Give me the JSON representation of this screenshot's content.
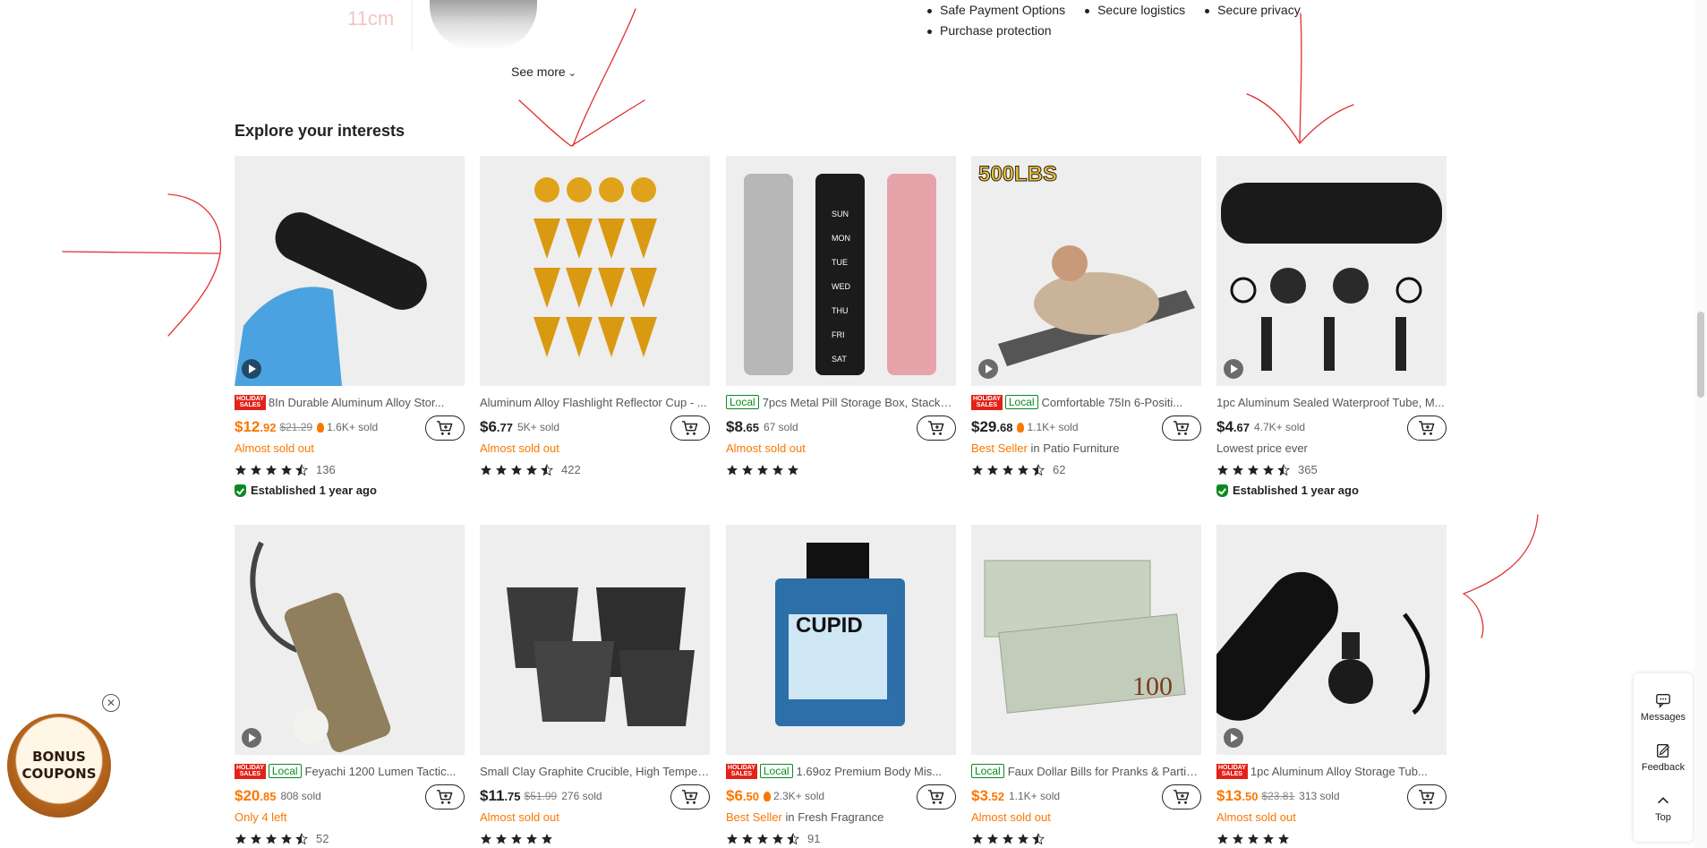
{
  "previous_section": {
    "dimension_label": "11cm",
    "see_more_label": "See more"
  },
  "assurances": [
    "Safe Payment Options",
    "Secure logistics",
    "Secure privacy",
    "Purchase protection"
  ],
  "section_title": "Explore your interests",
  "badges": {
    "holiday_top": "HOLIDAY",
    "holiday_bottom": "SALES",
    "local": "Local"
  },
  "products": [
    {
      "title": "8In Durable Aluminum Alloy Stor...",
      "holiday": true,
      "local": false,
      "price_main": "$12",
      "price_cents": ".92",
      "sale": true,
      "orig_price": "$21.29",
      "flame": true,
      "sold": "1.6K+ sold",
      "note": "Almost sold out",
      "note_type": "orange",
      "rating": 4.5,
      "reviews": "136",
      "established": "Established 1 year ago",
      "video": true
    },
    {
      "title": "Aluminum Alloy Flashlight Reflector Cup - ...",
      "holiday": false,
      "local": false,
      "price_main": "$6",
      "price_cents": ".77",
      "sale": false,
      "orig_price": "",
      "flame": false,
      "sold": "5K+ sold",
      "note": "Almost sold out",
      "note_type": "orange",
      "rating": 4.5,
      "reviews": "422",
      "established": "",
      "video": false
    },
    {
      "title": "7pcs Metal Pill Storage Box, Stacka...",
      "holiday": false,
      "local": true,
      "price_main": "$8",
      "price_cents": ".65",
      "sale": false,
      "orig_price": "",
      "flame": false,
      "sold": "67 sold",
      "note": "Almost sold out",
      "note_type": "orange",
      "rating": 5,
      "reviews": "",
      "established": "",
      "video": false
    },
    {
      "title": "Comfortable 75In 6-Positi...",
      "holiday": true,
      "local": true,
      "price_main": "$29",
      "price_cents": ".68",
      "sale": false,
      "orig_price": "",
      "flame": true,
      "sold": "1.1K+ sold",
      "note": "Best Seller",
      "note_suffix": " in Patio Furniture",
      "note_type": "bestseller",
      "rating": 4.5,
      "reviews": "62",
      "established": "",
      "video": true
    },
    {
      "title": "1pc Aluminum Sealed Waterproof Tube, M...",
      "holiday": false,
      "local": false,
      "price_main": "$4",
      "price_cents": ".67",
      "sale": false,
      "orig_price": "",
      "flame": false,
      "sold": "4.7K+ sold",
      "note": "Lowest price ever",
      "note_type": "gray",
      "rating": 4.5,
      "reviews": "365",
      "established": "Established 1 year ago",
      "video": true
    },
    {
      "title": "Feyachi 1200 Lumen Tactic...",
      "holiday": true,
      "local": true,
      "price_main": "$20",
      "price_cents": ".85",
      "sale": true,
      "orig_price": "",
      "flame": false,
      "sold": "808 sold",
      "note": "Only 4 left",
      "note_type": "orange",
      "rating": 4.5,
      "reviews": "52",
      "established": "",
      "video": true
    },
    {
      "title": "Small Clay Graphite Crucible, High Temper...",
      "holiday": false,
      "local": false,
      "price_main": "$11",
      "price_cents": ".75",
      "sale": false,
      "orig_price": "$51.99",
      "flame": false,
      "sold": "276 sold",
      "note": "Almost sold out",
      "note_type": "orange",
      "rating": 5,
      "reviews": "",
      "established": "",
      "video": false
    },
    {
      "title": "1.69oz Premium Body Mis...",
      "holiday": true,
      "local": true,
      "price_main": "$6",
      "price_cents": ".50",
      "sale": true,
      "orig_price": "",
      "flame": true,
      "sold": "2.3K+ sold",
      "note": "Best Seller",
      "note_suffix": " in Fresh Fragrance",
      "note_type": "bestseller",
      "rating": 4.5,
      "reviews": "91",
      "established": "",
      "video": false
    },
    {
      "title": "Faux Dollar Bills for Pranks & Partie...",
      "holiday": false,
      "local": true,
      "price_main": "$3",
      "price_cents": ".52",
      "sale": true,
      "orig_price": "",
      "flame": false,
      "sold": "1.1K+ sold",
      "note": "Almost sold out",
      "note_type": "orange",
      "rating": 4.5,
      "reviews": "",
      "established": "",
      "video": false
    },
    {
      "title": "1pc Aluminum Alloy Storage Tub...",
      "holiday": true,
      "local": false,
      "price_main": "$13",
      "price_cents": ".50",
      "sale": true,
      "orig_price": "$23.81",
      "flame": false,
      "sold": "313 sold",
      "note": "Almost sold out",
      "note_type": "orange",
      "rating": 5,
      "reviews": "",
      "established": "",
      "video": true
    }
  ],
  "product_image_text": {
    "p4_overlay": "500LBS",
    "p8_brand": "CUPID",
    "p3_days": [
      "SUN",
      "MON",
      "TUE",
      "WED",
      "THU",
      "FRI",
      "SAT"
    ],
    "p9_bill": "100"
  },
  "side_tools": {
    "messages": "Messages",
    "feedback": "Feedback",
    "top": "Top"
  },
  "bonus": {
    "line1": "BONUS",
    "line2": "COUPONS"
  },
  "colors": {
    "accent_orange": "#fb7701",
    "holiday_red": "#e2231a",
    "local_green": "#0a8a1f",
    "annotation_red": "#e03030"
  }
}
